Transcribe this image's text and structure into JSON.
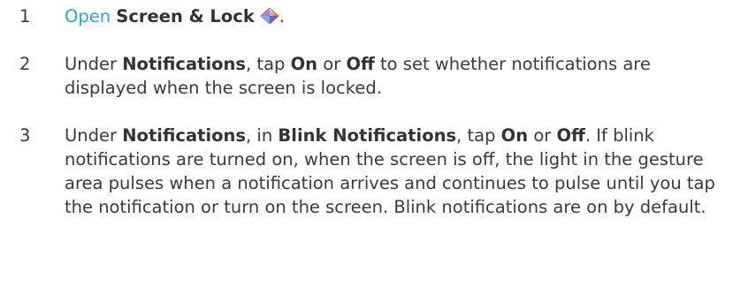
{
  "steps": [
    {
      "number": "1",
      "link_text": "Open",
      "app_name": "Screen & Lock",
      "icon": "screen-lock-app-icon",
      "period": "."
    },
    {
      "number": "2",
      "under": "Under",
      "section": "Notifications",
      "comma_tap": ", tap",
      "on": "On",
      "or": "or",
      "off": "Off",
      "rest": "to set whether notifications are displayed when the screen is locked."
    },
    {
      "number": "3",
      "under": "Under",
      "section": "Notifications",
      "comma_in": ", in",
      "subsection": "Blink Notifications",
      "comma_tap": ", tap",
      "on": "On",
      "or": "or",
      "off": "Off",
      "rest": ". If blink notifications are turned on, when the screen is off, the light in the gesture area pulses when a notification arrives and continues to pulse until you tap the notification or turn on the screen. Blink notifications are on by default."
    }
  ],
  "colors": {
    "link": "#2fa3d6",
    "text": "#3a3a3a"
  }
}
